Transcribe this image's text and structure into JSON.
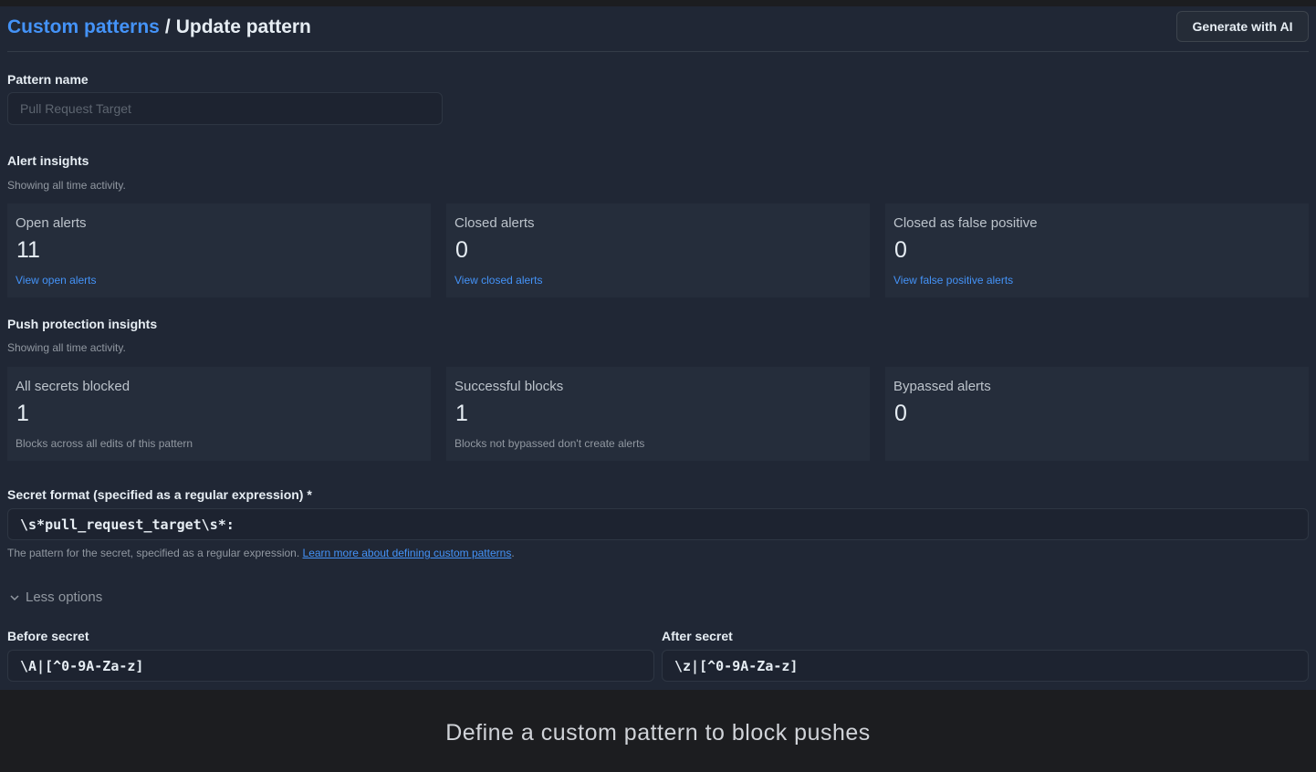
{
  "header": {
    "breadcrumb_link": "Custom patterns",
    "breadcrumb_sep": "/",
    "breadcrumb_current": "Update pattern",
    "generate_button": "Generate with AI"
  },
  "pattern_name": {
    "label": "Pattern name",
    "placeholder": "Pull Request Target"
  },
  "alert_insights": {
    "title": "Alert insights",
    "subtitle": "Showing all time activity.",
    "cards": [
      {
        "title": "Open alerts",
        "value": "11",
        "link": "View open alerts"
      },
      {
        "title": "Closed alerts",
        "value": "0",
        "link": "View closed alerts"
      },
      {
        "title": "Closed as false positive",
        "value": "0",
        "link": "View false positive alerts"
      }
    ]
  },
  "push_insights": {
    "title": "Push protection insights",
    "subtitle": "Showing all time activity.",
    "cards": [
      {
        "title": "All secrets blocked",
        "value": "1",
        "note": "Blocks across all edits of this pattern"
      },
      {
        "title": "Successful blocks",
        "value": "1",
        "note": "Blocks not bypassed don't create alerts"
      },
      {
        "title": "Bypassed alerts",
        "value": "0"
      }
    ]
  },
  "secret_format": {
    "label": "Secret format (specified as a regular expression) *",
    "value": "\\s*pull_request_target\\s*:",
    "help_text": "The pattern for the secret, specified as a regular expression. ",
    "help_link": "Learn more about defining custom patterns",
    "help_end": "."
  },
  "options": {
    "toggle_label": "Less options",
    "before_label": "Before secret",
    "before_value": "\\A|[^0-9A-Za-z]",
    "after_label": "After secret",
    "after_value": "\\z|[^0-9A-Za-z]"
  },
  "caption": "Define a custom pattern to block pushes"
}
